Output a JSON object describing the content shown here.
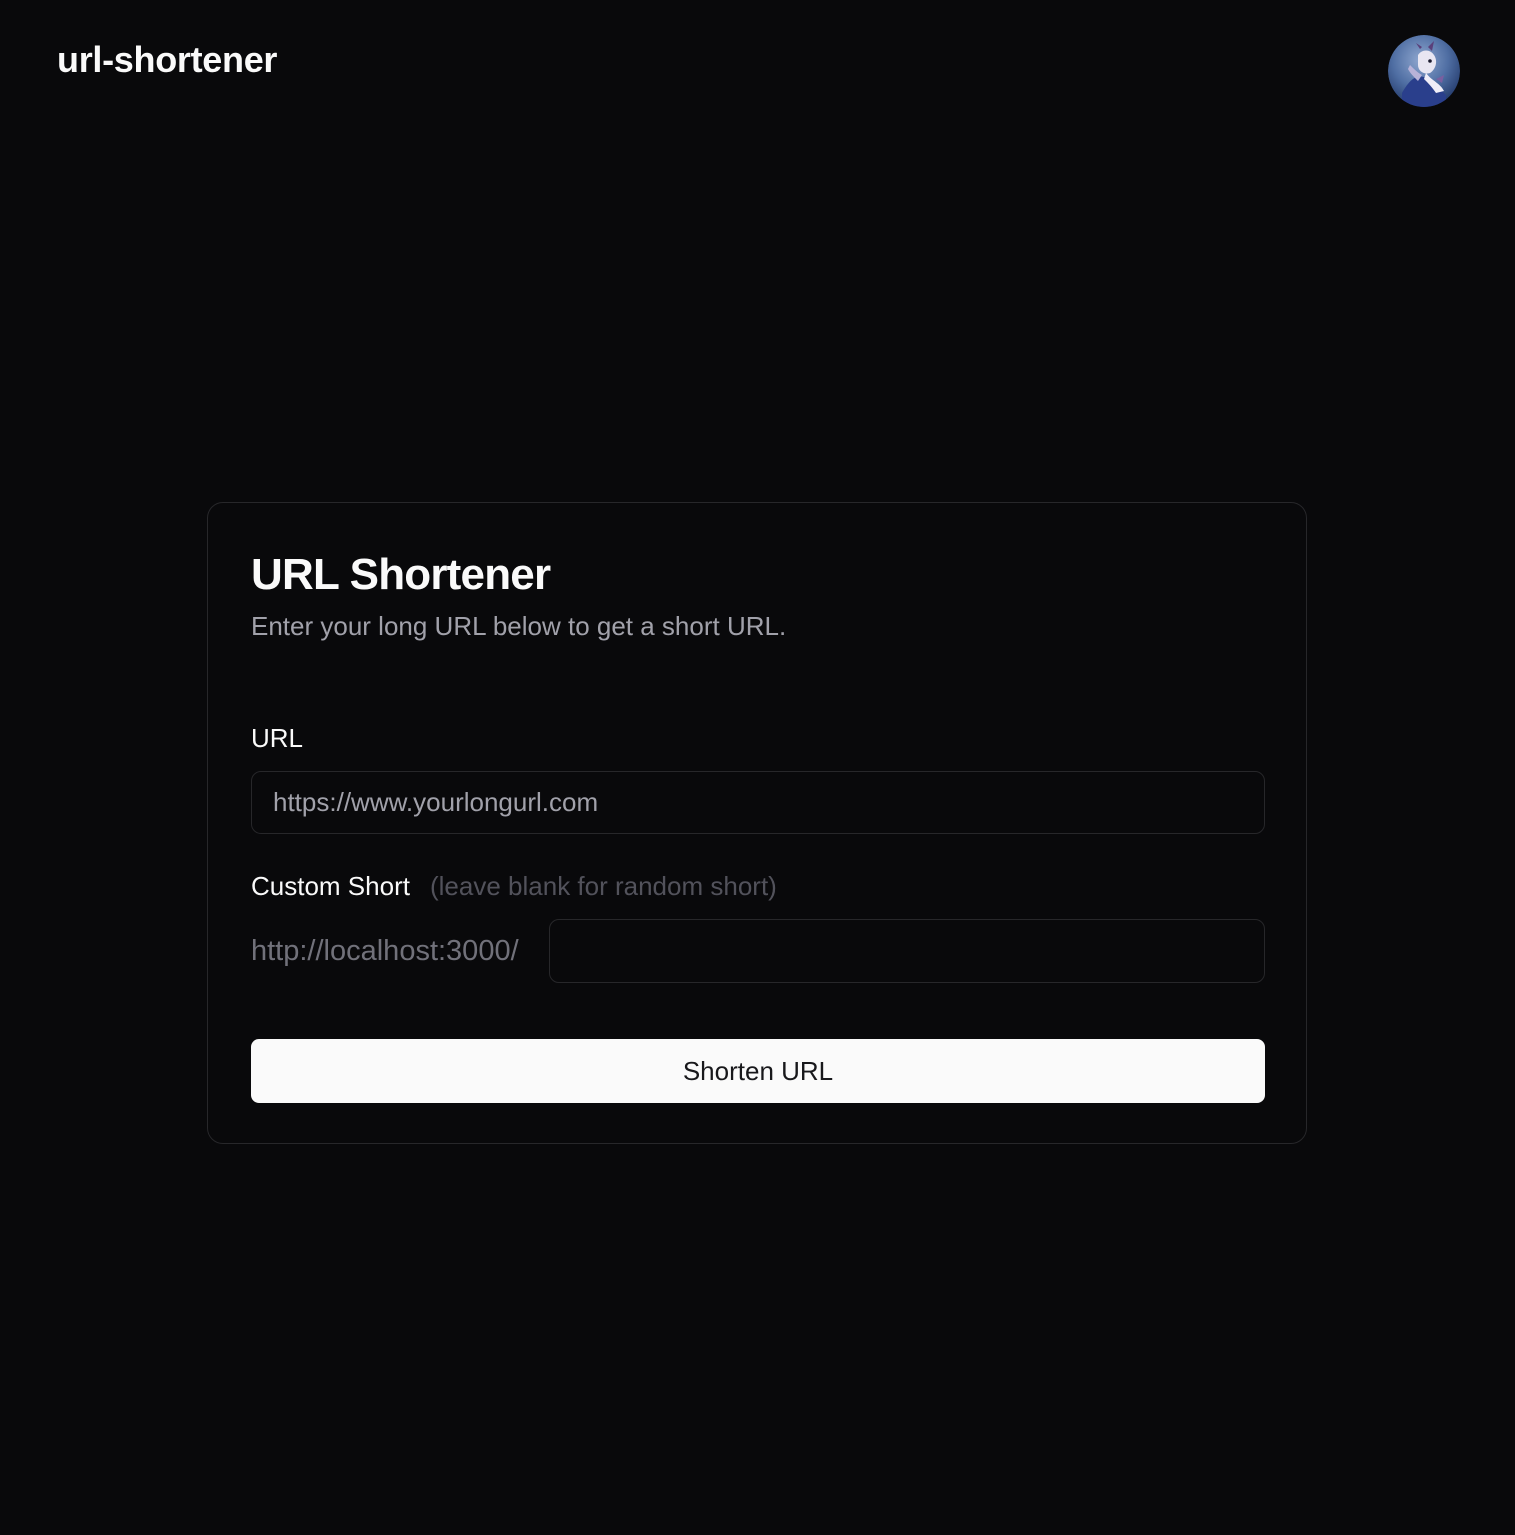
{
  "header": {
    "brand": "url-shortener",
    "avatar_icon": "user-avatar-illustration"
  },
  "card": {
    "title": "URL Shortener",
    "description": "Enter your long URL below to get a short URL.",
    "url_label": "URL",
    "url_input": {
      "placeholder": "https://www.yourlongurl.com",
      "value": ""
    },
    "custom_label": "Custom Short",
    "custom_hint": "(leave blank for random short)",
    "custom_prefix": "http://localhost:3000/",
    "custom_input": {
      "placeholder": "",
      "value": ""
    },
    "submit_label": "Shorten URL"
  },
  "colors": {
    "background": "#09090b",
    "border": "#27272a",
    "text_primary": "#fafafa",
    "text_muted": "#a1a1aa",
    "button_bg": "#fafafa",
    "button_text": "#18181b"
  }
}
